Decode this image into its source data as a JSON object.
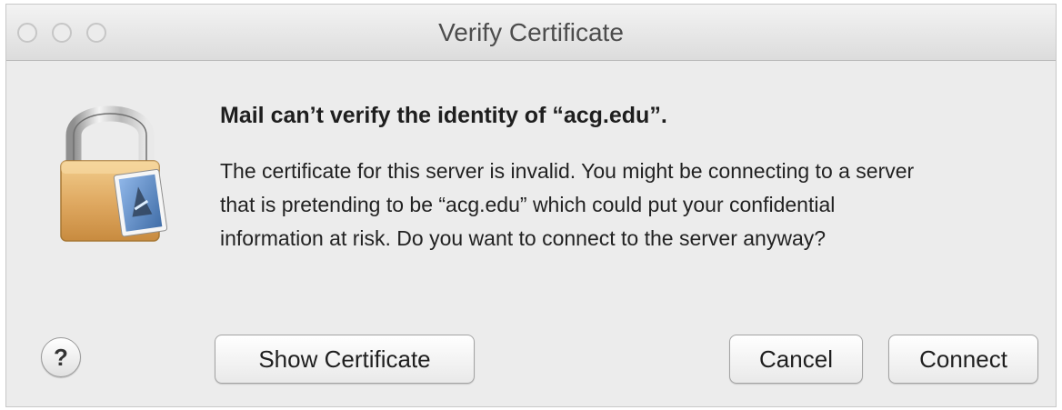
{
  "window": {
    "title": "Verify Certificate"
  },
  "dialog": {
    "heading": "Mail can’t verify the identity of “acg.edu”.",
    "message_lines": [
      "The certificate for this server is invalid. You might be connecting to a server",
      "that is pretending to be “acg.edu” which could put your confidential",
      "information at risk. Do you want to connect to the server anyway?"
    ],
    "icon": "padlock-with-mail-stamp-icon"
  },
  "buttons": {
    "help": "?",
    "show_certificate": "Show Certificate",
    "cancel": "Cancel",
    "connect": "Connect"
  }
}
